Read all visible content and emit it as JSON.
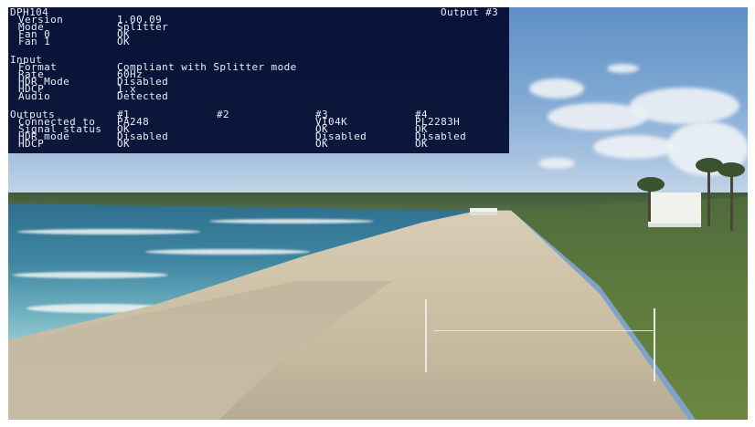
{
  "device": "DPH104",
  "header_right": "Output #3",
  "system": [
    {
      "label": "Version",
      "value": "1.00.09"
    },
    {
      "label": "Mode",
      "value": "Splitter"
    },
    {
      "label": "Fan 0",
      "value": "OK"
    },
    {
      "label": "Fan 1",
      "value": "OK"
    }
  ],
  "input": {
    "title": "Input",
    "rows": [
      {
        "label": "Format",
        "value": "Compliant with Splitter mode"
      },
      {
        "label": "Rate",
        "value": "60Hz"
      },
      {
        "label": "HDR Mode",
        "value": "Disabled"
      },
      {
        "label": "HDCP",
        "value": "1.x"
      },
      {
        "label": "Audio",
        "value": "Detected"
      }
    ]
  },
  "outputs": {
    "title": "Outputs",
    "columns": [
      "#1",
      "#2",
      "#3",
      "#4"
    ],
    "rows": [
      {
        "label": "Connected to",
        "values": [
          "PA248",
          "",
          "VI04K",
          "PL2283H"
        ]
      },
      {
        "label": "Signal status",
        "values": [
          "OK",
          "",
          "OK",
          "OK"
        ]
      },
      {
        "label": "HDR mode",
        "values": [
          "Disabled",
          "",
          "Disabled",
          "Disabled"
        ]
      },
      {
        "label": "HDCP",
        "values": [
          "OK",
          "",
          "OK",
          "OK"
        ]
      }
    ]
  },
  "colors": {
    "osd_background": "#020a2e",
    "osd_text": "#e9ecf4"
  }
}
